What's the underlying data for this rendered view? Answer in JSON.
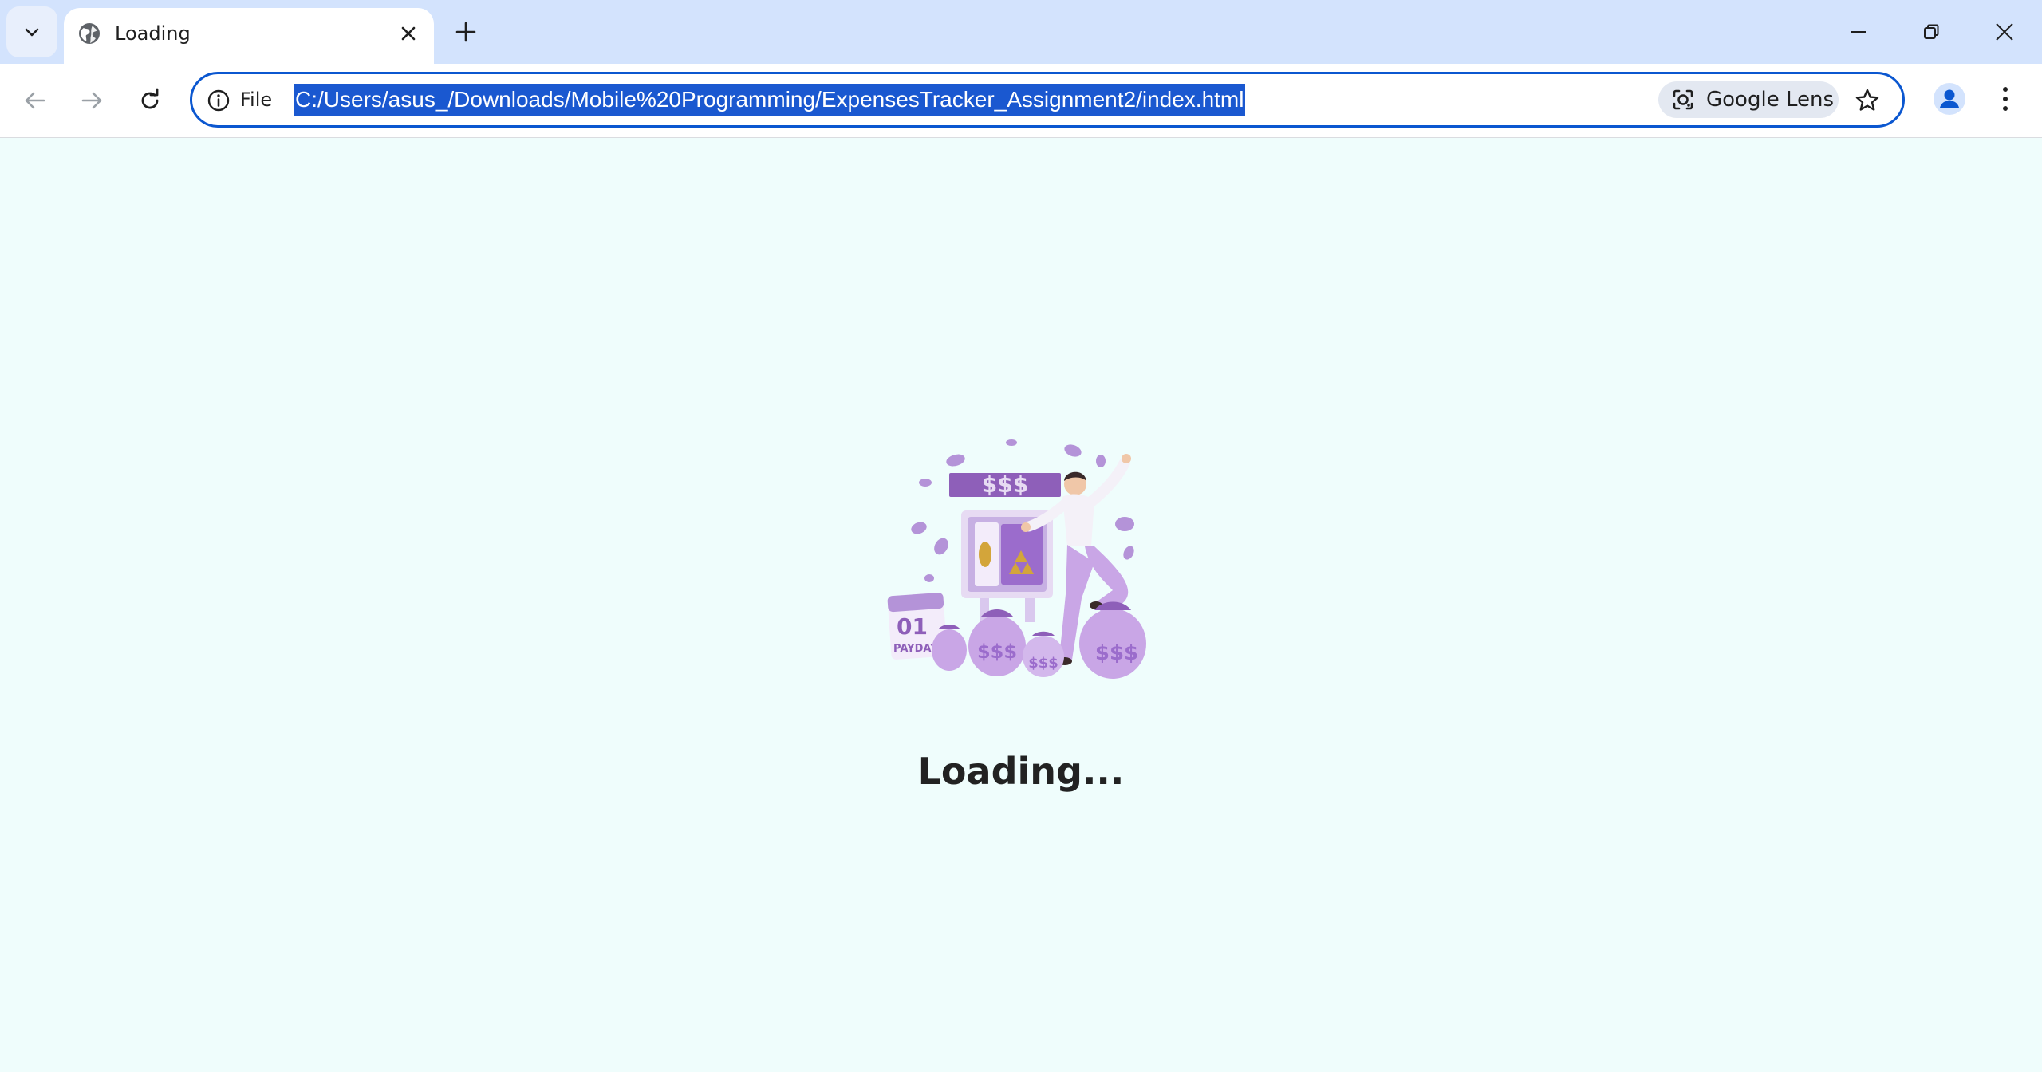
{
  "browser": {
    "tab": {
      "title": "Loading"
    },
    "omnibox": {
      "scheme_label": "File",
      "url": "C:/Users/asus_/Downloads/Mobile%20Programming/ExpensesTracker_Assignment2/index.html",
      "lens_label": "Google Lens"
    },
    "icons": {
      "tab_search": "chevron-down-icon",
      "favicon": "globe-icon",
      "close": "close-icon",
      "new_tab": "plus-icon",
      "minimize": "minimize-icon",
      "restore": "restore-icon",
      "window_close": "close-icon",
      "back": "arrow-left-icon",
      "forward": "arrow-right-icon",
      "reload": "reload-icon",
      "info": "info-icon",
      "lens": "camera-lens-icon",
      "bookmark": "star-icon",
      "profile": "person-icon",
      "menu": "kebab-menu-icon"
    },
    "colors": {
      "tabstrip": "#d3e3fd",
      "omnibox_border": "#0b57d0",
      "selection": "#1a58d0"
    }
  },
  "page": {
    "loading_text": "Loading...",
    "illustration": {
      "name": "payday-money-illustration",
      "colors": {
        "primary": "#b493d8",
        "dark": "#8e5fb9",
        "light": "#e7dbf3",
        "gold": "#d3a53a"
      },
      "calendar_lettering": [
        "01",
        "PAYDAY"
      ],
      "bag_lettering": "$$$",
      "banner_lettering": "$$$"
    },
    "background": "#effdfc"
  }
}
